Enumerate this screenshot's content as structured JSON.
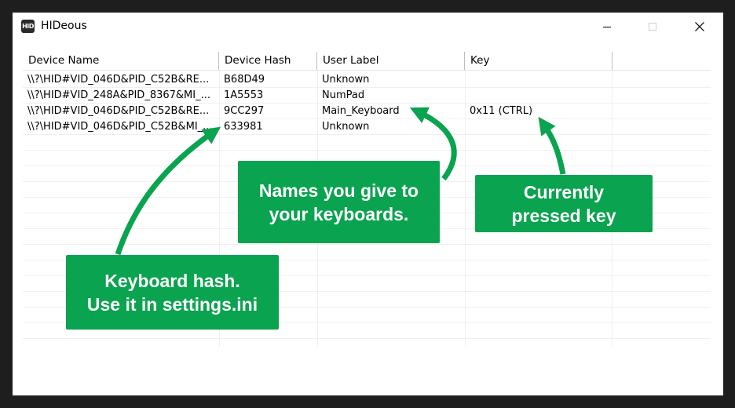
{
  "window": {
    "title": "HIDeous",
    "icon_text": "HID",
    "controls": [
      "minimize",
      "maximize",
      "close"
    ]
  },
  "listview": {
    "columns": [
      "Device Name",
      "Device Hash",
      "User Label",
      "Key"
    ],
    "rows": [
      [
        "\\\\?\\HID#VID_046D&PID_C52B&RE...",
        "B68D49",
        "Unknown",
        ""
      ],
      [
        "\\\\?\\HID#VID_248A&PID_8367&MI_...",
        "1A5553",
        "NumPad",
        ""
      ],
      [
        "\\\\?\\HID#VID_046D&PID_C52B&RE...",
        "9CC297",
        "Main_Keyboard",
        "0x11 (CTRL)"
      ],
      [
        "\\\\?\\HID#VID_046D&PID_C52B&MI_...",
        "633981",
        "Unknown",
        ""
      ]
    ]
  },
  "callouts": {
    "labels": {
      "line1": "Names you give to",
      "line2": "your keyboards."
    },
    "key": {
      "line1": "Currently",
      "line2": "pressed key"
    },
    "hash": {
      "line1": "Keyboard hash.",
      "line2": "Use it in settings.ini"
    },
    "color": "#0aa34f"
  }
}
